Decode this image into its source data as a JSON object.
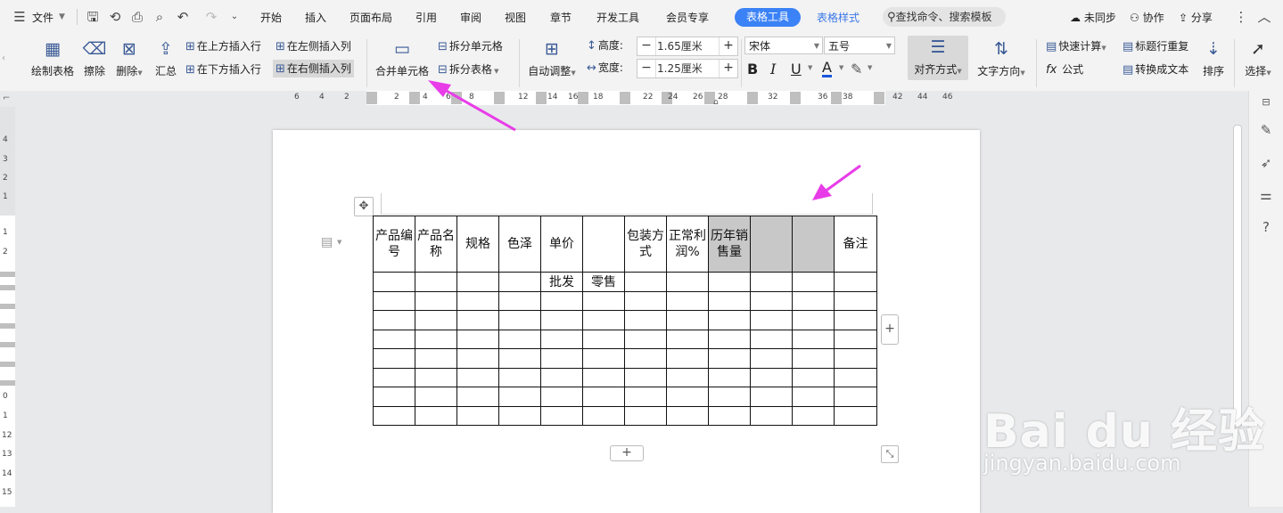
{
  "menubar": {
    "file": "文件",
    "tabs": [
      "开始",
      "插入",
      "页面布局",
      "引用",
      "审阅",
      "视图",
      "章节",
      "开发工具",
      "会员专享"
    ],
    "active_tab": "表格工具",
    "table_style_tab": "表格样式",
    "search_placeholder": "查找命令、搜索模板",
    "sync": "未同步",
    "collab": "协作",
    "share": "分享"
  },
  "ribbon": {
    "draw_table": "绘制表格",
    "erase": "擦除",
    "delete": "删除",
    "summary": "汇总",
    "insert_row_above": "在上方插入行",
    "insert_row_below": "在下方插入行",
    "insert_col_left": "在左侧插入列",
    "insert_col_right": "在右侧插入列",
    "merge_cells": "合并单元格",
    "split_cells": "拆分单元格",
    "split_table": "拆分表格",
    "auto_adjust": "自动调整",
    "height_label": "高度:",
    "height_value": "1.65厘米",
    "width_label": "宽度:",
    "width_value": "1.25厘米",
    "font_name": "宋体",
    "font_size": "五号",
    "align": "对齐方式",
    "text_direction": "文字方向",
    "quick_calc": "快速计算",
    "formula": "公式",
    "repeat_header": "标题行重复",
    "to_text": "转换成文本",
    "sort": "排序",
    "select": "选择"
  },
  "ruler": {
    "h_ticks": [
      "6",
      "4",
      "2",
      "2",
      "4",
      "6",
      "8",
      "12",
      "14",
      "16",
      "18",
      "22",
      "24",
      "26",
      "28",
      "32",
      "36",
      "38",
      "42",
      "44",
      "46"
    ],
    "v_ticks": [
      "4",
      "3",
      "2",
      "1",
      "1",
      "2",
      "0",
      "1",
      "12",
      "13",
      "14",
      "15"
    ]
  },
  "table": {
    "rows": [
      [
        "产品编号",
        "产品名称",
        "规格",
        "色泽",
        "单价",
        "",
        "包装方式",
        "正常利润%",
        "历年销售量",
        "",
        "",
        "备注"
      ],
      [
        "",
        "",
        "",
        "",
        "批发",
        "零售",
        "",
        "",
        "",
        "",
        "",
        ""
      ],
      [
        "",
        "",
        "",
        "",
        "",
        "",
        "",
        "",
        "",
        "",
        "",
        ""
      ],
      [
        "",
        "",
        "",
        "",
        "",
        "",
        "",
        "",
        "",
        "",
        "",
        ""
      ],
      [
        "",
        "",
        "",
        "",
        "",
        "",
        "",
        "",
        "",
        "",
        "",
        ""
      ],
      [
        "",
        "",
        "",
        "",
        "",
        "",
        "",
        "",
        "",
        "",
        "",
        ""
      ],
      [
        "",
        "",
        "",
        "",
        "",
        "",
        "",
        "",
        "",
        "",
        "",
        ""
      ],
      [
        "",
        "",
        "",
        "",
        "",
        "",
        "",
        "",
        "",
        "",
        "",
        ""
      ],
      [
        "",
        "",
        "",
        "",
        "",
        "",
        "",
        "",
        "",
        "",
        "",
        ""
      ]
    ]
  },
  "watermark": {
    "logo": "Bai du 经验",
    "url": "jingyan.baidu.com"
  },
  "colors": {
    "accent": "#3b82f6",
    "arrow": "#e83ce8",
    "selected_cell": "#c8c8c8"
  }
}
